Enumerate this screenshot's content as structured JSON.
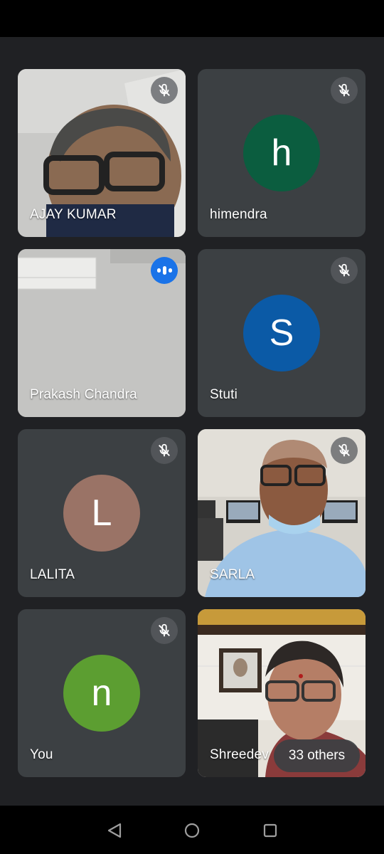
{
  "participants": [
    {
      "name": "AJAY KUMAR",
      "muted": true,
      "video": true
    },
    {
      "name": "himendra",
      "muted": true,
      "initial": "h",
      "avatar_color": "#0b5d3f"
    },
    {
      "name": "Prakash Chandra",
      "muted": false,
      "speaking": true,
      "video": true
    },
    {
      "name": "Stuti",
      "muted": true,
      "initial": "S",
      "avatar_color": "#0b5aa6"
    },
    {
      "name": "LALITA",
      "muted": true,
      "initial": "L",
      "avatar_color": "#9a7366"
    },
    {
      "name": "SARLA",
      "muted": true,
      "video": true
    },
    {
      "name": "You",
      "muted": true,
      "initial": "n",
      "avatar_color": "#5c9e31"
    },
    {
      "name": "Shreedev",
      "muted": false,
      "video": true
    }
  ],
  "others_label": "33 others",
  "icons": {
    "mute": "mic-off-icon",
    "speaking": "audio-level-icon",
    "nav": [
      "back-triangle-icon",
      "home-circle-icon",
      "recents-square-icon"
    ]
  },
  "colors": {
    "background": "#202124",
    "tile": "#3c4043",
    "speaking": "#1a73e8"
  }
}
